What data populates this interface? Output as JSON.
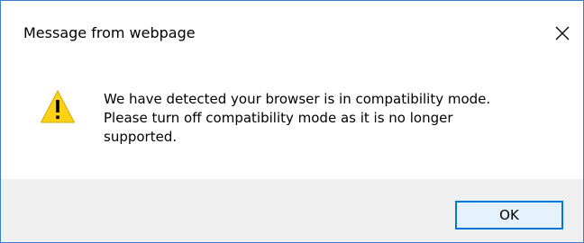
{
  "dialog": {
    "title": "Message from webpage",
    "close_icon": "close-icon",
    "warning_icon": "warning-triangle-icon",
    "message_lines": [
      "We have detected your browser is in compatibility mode.",
      "Please turn off compatibility mode as it is no longer",
      "supported."
    ],
    "ok_label": "OK"
  },
  "colors": {
    "border": "#3e7fcc",
    "footer_bg": "#f0f0f0",
    "button_border": "#0078d7",
    "button_bg": "#e5f1fb",
    "warning_fill": "#fcd116"
  }
}
